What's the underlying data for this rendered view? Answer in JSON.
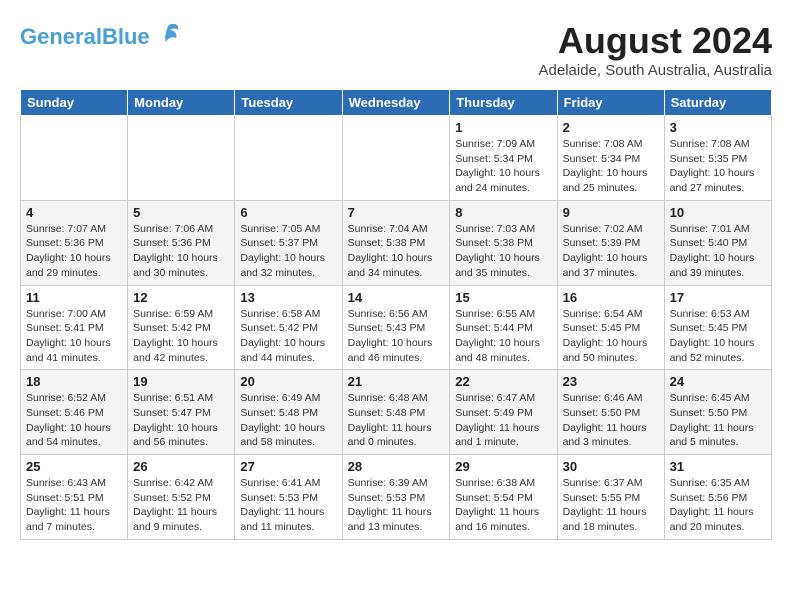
{
  "header": {
    "logo_general": "General",
    "logo_blue": "Blue",
    "month_year": "August 2024",
    "location": "Adelaide, South Australia, Australia"
  },
  "days_of_week": [
    "Sunday",
    "Monday",
    "Tuesday",
    "Wednesday",
    "Thursday",
    "Friday",
    "Saturday"
  ],
  "weeks": [
    [
      {
        "day": "",
        "sunrise": "",
        "sunset": "",
        "daylight": ""
      },
      {
        "day": "",
        "sunrise": "",
        "sunset": "",
        "daylight": ""
      },
      {
        "day": "",
        "sunrise": "",
        "sunset": "",
        "daylight": ""
      },
      {
        "day": "",
        "sunrise": "",
        "sunset": "",
        "daylight": ""
      },
      {
        "day": "1",
        "sunrise": "Sunrise: 7:09 AM",
        "sunset": "Sunset: 5:34 PM",
        "daylight": "Daylight: 10 hours and 24 minutes."
      },
      {
        "day": "2",
        "sunrise": "Sunrise: 7:08 AM",
        "sunset": "Sunset: 5:34 PM",
        "daylight": "Daylight: 10 hours and 25 minutes."
      },
      {
        "day": "3",
        "sunrise": "Sunrise: 7:08 AM",
        "sunset": "Sunset: 5:35 PM",
        "daylight": "Daylight: 10 hours and 27 minutes."
      }
    ],
    [
      {
        "day": "4",
        "sunrise": "Sunrise: 7:07 AM",
        "sunset": "Sunset: 5:36 PM",
        "daylight": "Daylight: 10 hours and 29 minutes."
      },
      {
        "day": "5",
        "sunrise": "Sunrise: 7:06 AM",
        "sunset": "Sunset: 5:36 PM",
        "daylight": "Daylight: 10 hours and 30 minutes."
      },
      {
        "day": "6",
        "sunrise": "Sunrise: 7:05 AM",
        "sunset": "Sunset: 5:37 PM",
        "daylight": "Daylight: 10 hours and 32 minutes."
      },
      {
        "day": "7",
        "sunrise": "Sunrise: 7:04 AM",
        "sunset": "Sunset: 5:38 PM",
        "daylight": "Daylight: 10 hours and 34 minutes."
      },
      {
        "day": "8",
        "sunrise": "Sunrise: 7:03 AM",
        "sunset": "Sunset: 5:38 PM",
        "daylight": "Daylight: 10 hours and 35 minutes."
      },
      {
        "day": "9",
        "sunrise": "Sunrise: 7:02 AM",
        "sunset": "Sunset: 5:39 PM",
        "daylight": "Daylight: 10 hours and 37 minutes."
      },
      {
        "day": "10",
        "sunrise": "Sunrise: 7:01 AM",
        "sunset": "Sunset: 5:40 PM",
        "daylight": "Daylight: 10 hours and 39 minutes."
      }
    ],
    [
      {
        "day": "11",
        "sunrise": "Sunrise: 7:00 AM",
        "sunset": "Sunset: 5:41 PM",
        "daylight": "Daylight: 10 hours and 41 minutes."
      },
      {
        "day": "12",
        "sunrise": "Sunrise: 6:59 AM",
        "sunset": "Sunset: 5:42 PM",
        "daylight": "Daylight: 10 hours and 42 minutes."
      },
      {
        "day": "13",
        "sunrise": "Sunrise: 6:58 AM",
        "sunset": "Sunset: 5:42 PM",
        "daylight": "Daylight: 10 hours and 44 minutes."
      },
      {
        "day": "14",
        "sunrise": "Sunrise: 6:56 AM",
        "sunset": "Sunset: 5:43 PM",
        "daylight": "Daylight: 10 hours and 46 minutes."
      },
      {
        "day": "15",
        "sunrise": "Sunrise: 6:55 AM",
        "sunset": "Sunset: 5:44 PM",
        "daylight": "Daylight: 10 hours and 48 minutes."
      },
      {
        "day": "16",
        "sunrise": "Sunrise: 6:54 AM",
        "sunset": "Sunset: 5:45 PM",
        "daylight": "Daylight: 10 hours and 50 minutes."
      },
      {
        "day": "17",
        "sunrise": "Sunrise: 6:53 AM",
        "sunset": "Sunset: 5:45 PM",
        "daylight": "Daylight: 10 hours and 52 minutes."
      }
    ],
    [
      {
        "day": "18",
        "sunrise": "Sunrise: 6:52 AM",
        "sunset": "Sunset: 5:46 PM",
        "daylight": "Daylight: 10 hours and 54 minutes."
      },
      {
        "day": "19",
        "sunrise": "Sunrise: 6:51 AM",
        "sunset": "Sunset: 5:47 PM",
        "daylight": "Daylight: 10 hours and 56 minutes."
      },
      {
        "day": "20",
        "sunrise": "Sunrise: 6:49 AM",
        "sunset": "Sunset: 5:48 PM",
        "daylight": "Daylight: 10 hours and 58 minutes."
      },
      {
        "day": "21",
        "sunrise": "Sunrise: 6:48 AM",
        "sunset": "Sunset: 5:48 PM",
        "daylight": "Daylight: 11 hours and 0 minutes."
      },
      {
        "day": "22",
        "sunrise": "Sunrise: 6:47 AM",
        "sunset": "Sunset: 5:49 PM",
        "daylight": "Daylight: 11 hours and 1 minute."
      },
      {
        "day": "23",
        "sunrise": "Sunrise: 6:46 AM",
        "sunset": "Sunset: 5:50 PM",
        "daylight": "Daylight: 11 hours and 3 minutes."
      },
      {
        "day": "24",
        "sunrise": "Sunrise: 6:45 AM",
        "sunset": "Sunset: 5:50 PM",
        "daylight": "Daylight: 11 hours and 5 minutes."
      }
    ],
    [
      {
        "day": "25",
        "sunrise": "Sunrise: 6:43 AM",
        "sunset": "Sunset: 5:51 PM",
        "daylight": "Daylight: 11 hours and 7 minutes."
      },
      {
        "day": "26",
        "sunrise": "Sunrise: 6:42 AM",
        "sunset": "Sunset: 5:52 PM",
        "daylight": "Daylight: 11 hours and 9 minutes."
      },
      {
        "day": "27",
        "sunrise": "Sunrise: 6:41 AM",
        "sunset": "Sunset: 5:53 PM",
        "daylight": "Daylight: 11 hours and 11 minutes."
      },
      {
        "day": "28",
        "sunrise": "Sunrise: 6:39 AM",
        "sunset": "Sunset: 5:53 PM",
        "daylight": "Daylight: 11 hours and 13 minutes."
      },
      {
        "day": "29",
        "sunrise": "Sunrise: 6:38 AM",
        "sunset": "Sunset: 5:54 PM",
        "daylight": "Daylight: 11 hours and 16 minutes."
      },
      {
        "day": "30",
        "sunrise": "Sunrise: 6:37 AM",
        "sunset": "Sunset: 5:55 PM",
        "daylight": "Daylight: 11 hours and 18 minutes."
      },
      {
        "day": "31",
        "sunrise": "Sunrise: 6:35 AM",
        "sunset": "Sunset: 5:56 PM",
        "daylight": "Daylight: 11 hours and 20 minutes."
      }
    ]
  ]
}
